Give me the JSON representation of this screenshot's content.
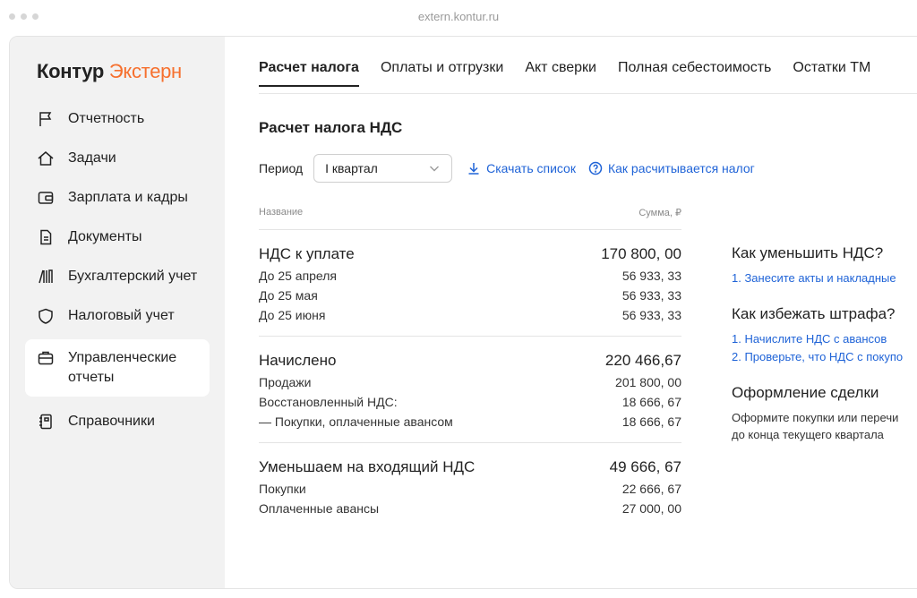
{
  "browser": {
    "url": "extern.kontur.ru"
  },
  "logo": {
    "brand": "Контур",
    "product": " Экстерн"
  },
  "sidebar": {
    "items": [
      {
        "label": "Отчетность",
        "icon": "flag-icon"
      },
      {
        "label": "Задачи",
        "icon": "home-icon"
      },
      {
        "label": "Зарплата и кадры",
        "icon": "wallet-icon"
      },
      {
        "label": "Документы",
        "icon": "document-icon"
      },
      {
        "label": "Бухгалтерский учет",
        "icon": "books-icon"
      },
      {
        "label": "Налоговый учет",
        "icon": "shield-icon"
      },
      {
        "label": "Управленческие отчеты",
        "icon": "briefcase-icon",
        "active": true
      },
      {
        "label": "Справочники",
        "icon": "notebook-icon"
      }
    ]
  },
  "tabs": [
    {
      "label": "Расчет налога",
      "active": true
    },
    {
      "label": "Оплаты и отгрузки"
    },
    {
      "label": "Акт сверки"
    },
    {
      "label": "Полная себестоимость"
    },
    {
      "label": "Остатки ТМ"
    }
  ],
  "main": {
    "title": "Расчет налога НДС",
    "period_label": "Период",
    "period_value": "I квартал",
    "download_link": "Скачать список",
    "howto_link": "Как расчитывается налог"
  },
  "table": {
    "col_name": "Название",
    "col_sum": "Сумма, ₽",
    "groups": [
      {
        "title": "НДС к уплате",
        "total": "170 800, 00",
        "rows": [
          {
            "name": "До 25 апреля",
            "value": "56 933, 33"
          },
          {
            "name": "До 25 мая",
            "value": "56 933, 33"
          },
          {
            "name": "До 25 июня",
            "value": "56 933, 33"
          }
        ]
      },
      {
        "title": "Начислено",
        "total": "220 466,67",
        "rows": [
          {
            "name": "Продажи",
            "value": "201 800, 00"
          },
          {
            "name": "Восстановленный НДС:",
            "value": "18 666, 67"
          },
          {
            "name": "— Покупки, оплаченные авансом",
            "value": "18 666, 67"
          }
        ]
      },
      {
        "title": "Уменьшаем на входящий НДС",
        "total": "49 666, 67",
        "rows": [
          {
            "name": "Покупки",
            "value": "22 666, 67"
          },
          {
            "name": "Оплаченные авансы",
            "value": "27 000, 00"
          }
        ]
      }
    ]
  },
  "aside": {
    "reduce": {
      "title": "Как уменьшить НДС?",
      "tips": [
        "1.  Занесите акты и накладные"
      ]
    },
    "fine": {
      "title": "Как избежать штрафа?",
      "tips": [
        "1.  Начислите НДС с авансов",
        "2.  Проверьте, что НДС с покупо"
      ]
    },
    "deal": {
      "title": "Оформление сделки",
      "text1": "Оформите покупки или перечи",
      "text2": "до конца текущего квартала"
    }
  },
  "colors": {
    "accent": "#f6702e",
    "link": "#1f63d7",
    "sidebar_bg": "#f2f2f2"
  }
}
